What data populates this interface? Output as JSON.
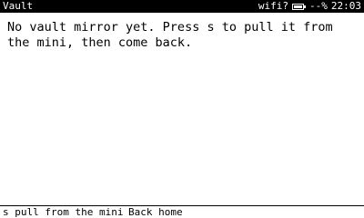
{
  "status_bar": {
    "title": "Vault",
    "wifi": "wifi?",
    "battery": "--%",
    "time": "22:03"
  },
  "main": {
    "message": "No vault mirror yet. Press s to pull it from the mini, then come back."
  },
  "bottom_bar": {
    "pull_hint": "s pull from the mini",
    "back_hint": "Back home"
  },
  "icons": {
    "battery": "battery-icon"
  },
  "colors": {
    "status_bar_background": "#000000",
    "status_bar_text": "#ffffff",
    "page_background": "#ffffff",
    "text": "#000000"
  }
}
